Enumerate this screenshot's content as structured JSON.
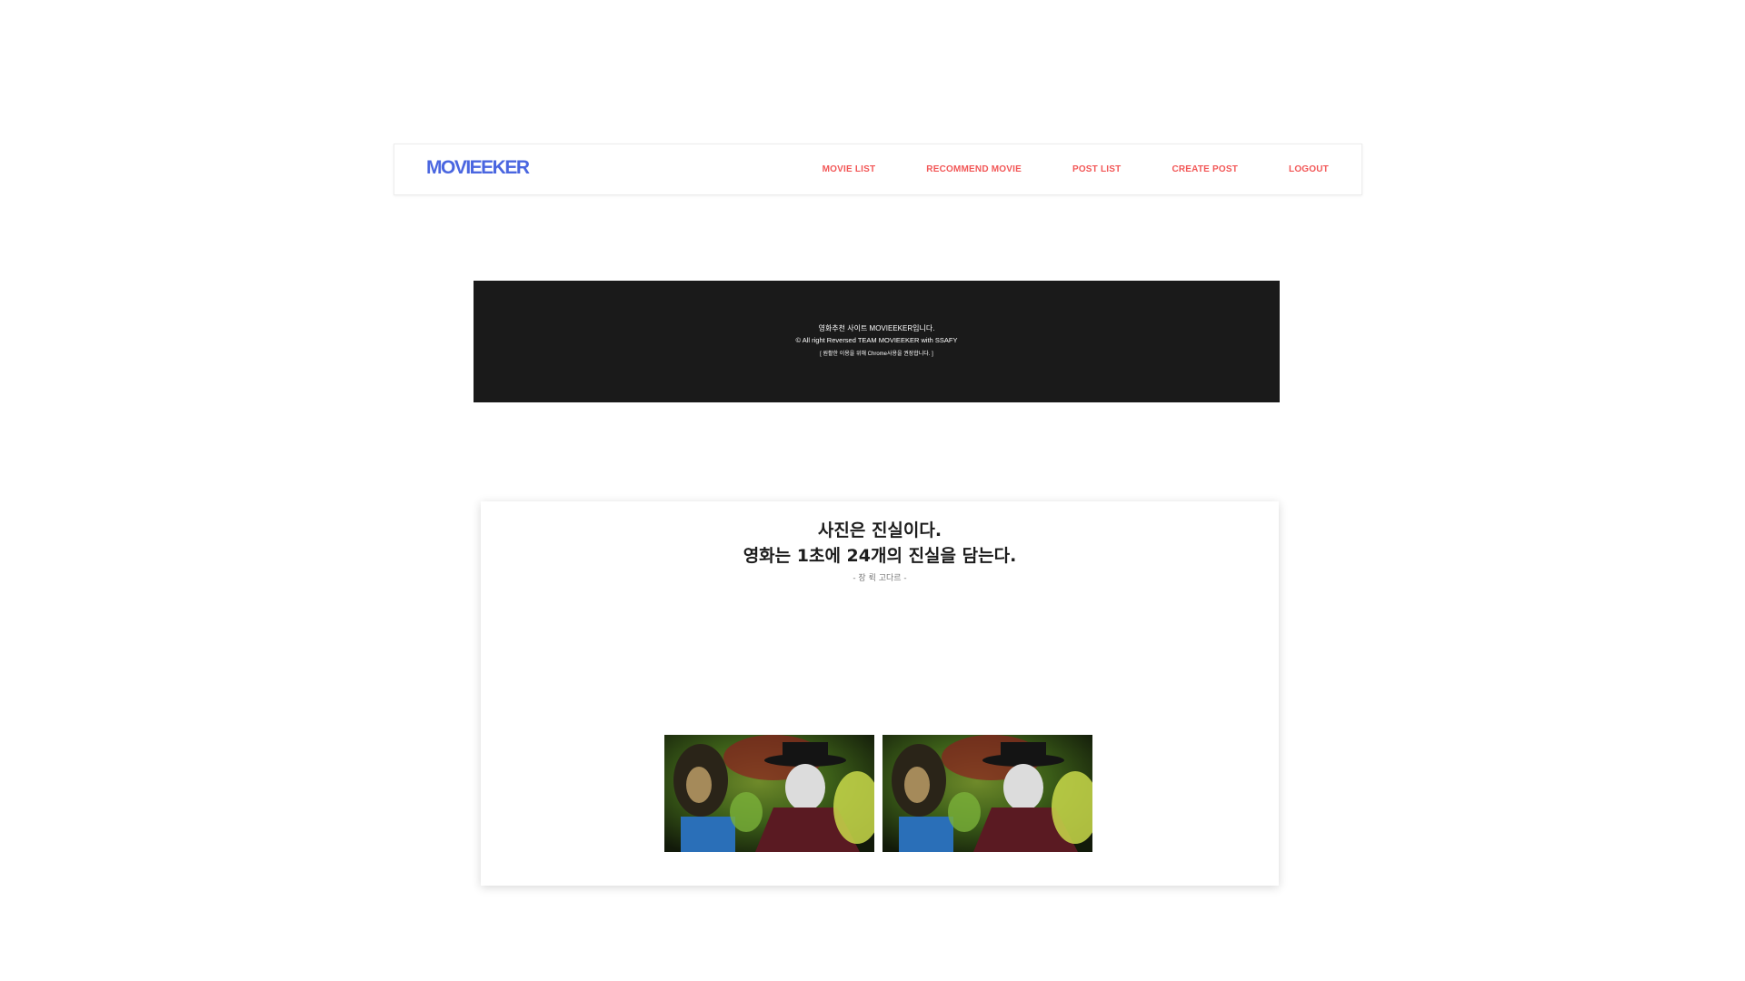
{
  "navbar": {
    "brand": "MOVIEEKER",
    "links": [
      "MOVIE LIST",
      "RECOMMEND MOVIE",
      "POST LIST",
      "CREATE POST",
      "LOGOUT"
    ]
  },
  "banner": {
    "line1": "영화추천 사이트 MOVIEEKER입니다.",
    "line2": "© All right Reversed TEAM MOVIEEKER with SSAFY",
    "line3": "[ 원활한 이용을 위해 Chrome사용을 권장합니다. ]"
  },
  "quote": {
    "line1": "사진은 진실이다.",
    "line2": "영화는 1초에 24개의 진실을 담는다.",
    "author": "- 장 뤽 고다르 -"
  },
  "stills": [
    {
      "alt": "movie-still"
    },
    {
      "alt": "movie-still"
    }
  ],
  "colors": {
    "brand": "#4a66e0",
    "nav_link": "#f25757",
    "banner_bg": "#1a1a1a"
  }
}
